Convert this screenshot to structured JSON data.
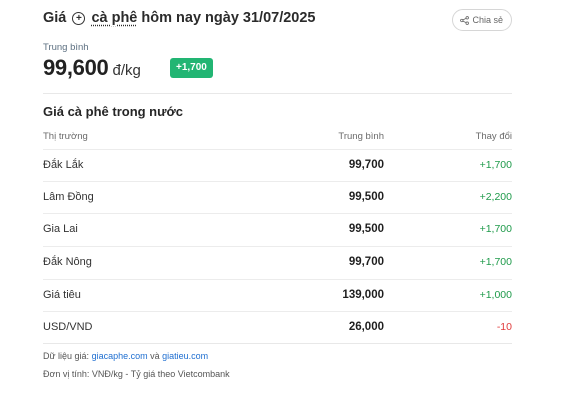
{
  "header": {
    "title_prefix": "Giá",
    "title_underlined": "cà phê",
    "title_suffix": "hôm nay ngày 31/07/2025",
    "share_label": "Chia sẻ"
  },
  "summary": {
    "avg_label": "Trung bình",
    "avg_value": "99,600",
    "avg_unit": "đ/kg",
    "change_badge": "+1,700",
    "badge_color": "#22b573"
  },
  "table": {
    "section_title": "Giá cà phê trong nước",
    "columns": [
      "Thị trường",
      "Trung bình",
      "Thay đổi"
    ],
    "rows": [
      {
        "market": "Đắk Lắk",
        "avg": "99,700",
        "change": "+1,700",
        "dir": "up"
      },
      {
        "market": "Lâm Đồng",
        "avg": "99,500",
        "change": "+2,200",
        "dir": "up"
      },
      {
        "market": "Gia Lai",
        "avg": "99,500",
        "change": "+1,700",
        "dir": "up"
      },
      {
        "market": "Đắk Nông",
        "avg": "99,700",
        "change": "+1,700",
        "dir": "up"
      },
      {
        "market": "Giá tiêu",
        "avg": "139,000",
        "change": "+1,000",
        "dir": "up"
      },
      {
        "market": "USD/VND",
        "avg": "26,000",
        "change": "-10",
        "dir": "down"
      }
    ]
  },
  "footer": {
    "source_label": "Dữ liệu giá:",
    "source_link_1": "giacaphe.com",
    "source_and": "và",
    "source_link_2": "giatieu.com",
    "unit_note": "Đơn vị tính: VNĐ/kg - Tỷ giá theo Vietcombank"
  },
  "colors": {
    "up": "#1e9a4a",
    "down": "#e03c3c",
    "link": "#1f6fd1"
  }
}
